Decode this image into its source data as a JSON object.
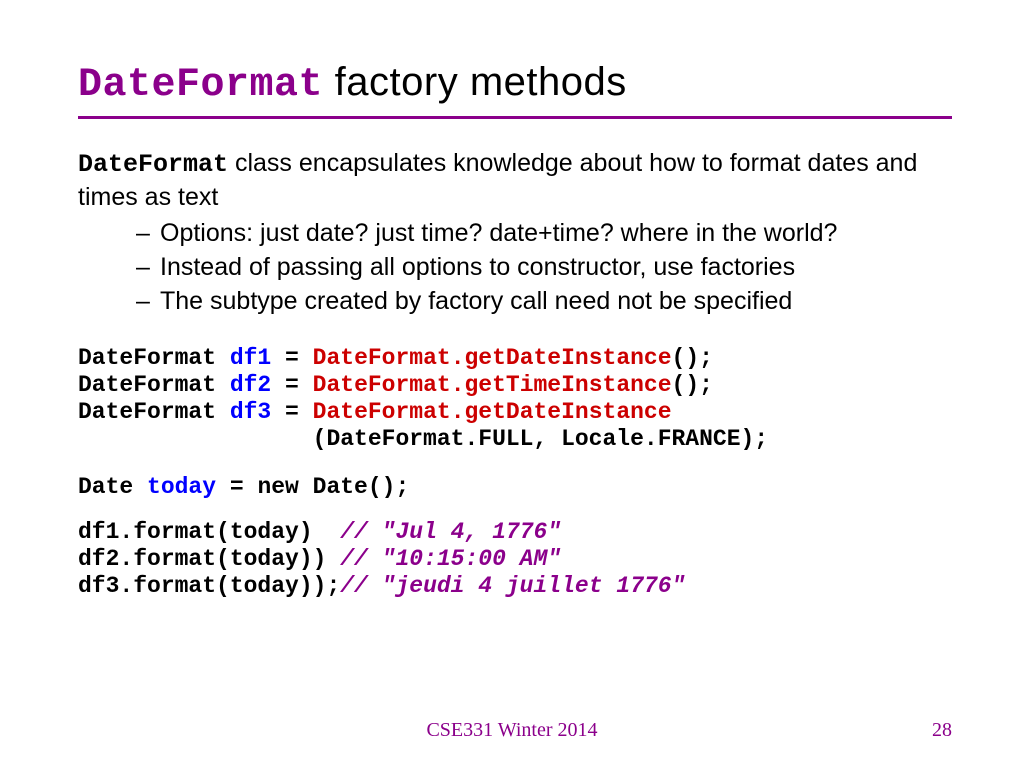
{
  "title": {
    "keyword": "DateFormat",
    "rest": " factory methods"
  },
  "intro": {
    "keyword": "DateFormat",
    "rest": " class encapsulates knowledge about how to format dates and times as text"
  },
  "bullets": [
    "Options: just date? just time? date+time? where in the world?",
    "Instead of passing all options to constructor, use factories",
    "The subtype created by factory call need not be specified"
  ],
  "code1": {
    "l1": {
      "a": "DateFormat ",
      "b": "df1",
      "c": " = ",
      "d": "DateFormat.getDateInstance",
      "e": "();"
    },
    "l2": {
      "a": "DateFormat ",
      "b": "df2",
      "c": " = ",
      "d": "DateFormat.getTimeInstance",
      "e": "();"
    },
    "l3": {
      "a": "DateFormat ",
      "b": "df3",
      "c": " = ",
      "d": "DateFormat.getDateInstance"
    },
    "l4": "                 (DateFormat.FULL, Locale.FRANCE);"
  },
  "code2": {
    "a": "Date ",
    "b": "today",
    "c": " = new Date();"
  },
  "code3": {
    "l1": {
      "a": "df1.format(today)  ",
      "b": "// \"Jul 4, 1776\""
    },
    "l2": {
      "a": "df2.format(today)) ",
      "b": "// \"10:15:00 AM\""
    },
    "l3": {
      "a": "df3.format(today));",
      "b": "// \"jeudi 4 juillet 1776\""
    }
  },
  "footer": "CSE331 Winter 2014",
  "page": "28"
}
